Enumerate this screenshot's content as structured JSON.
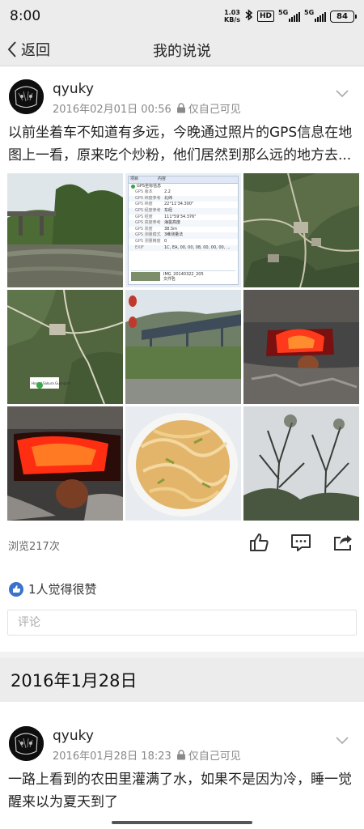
{
  "status_bar": {
    "time": "8:00",
    "speed_value": "1.03",
    "speed_unit": "KB/s",
    "hd_label": "HD",
    "sim1_label": "5G",
    "sim2_label": "5G",
    "battery": "84"
  },
  "nav": {
    "back_label": "返回",
    "title": "我的说说"
  },
  "posts": [
    {
      "username": "qyuky",
      "datetime": "2016年02月01日 00:56",
      "privacy": "仅自己可见",
      "text": "以前坐着车不知道有多远，今晚通过照片的GPS信息在地图上一看，原来吃个炒粉，他们居然到那么远的地方去...",
      "views": "浏览217次",
      "likes_text": "1人觉得很赞",
      "comment_placeholder": "评论"
    },
    {
      "username": "qyuky",
      "datetime": "2016年01月28日 18:23",
      "privacy": "仅自己可见",
      "text": "一路上看到的农田里灌满了水，如果不是因为冷，睡一觉醒来以为夏天到了"
    }
  ],
  "date_section": "2016年1月28日",
  "gps_panel": {
    "header_col1": "项目",
    "header_col2": "内容",
    "group": "GPS坐标信息",
    "rows": [
      [
        "GPS 版本",
        "2.2"
      ],
      [
        "GPS 纬度参考",
        "北纬"
      ],
      [
        "GPS 纬度",
        "22°11'34.300\""
      ],
      [
        "GPS 经度参考",
        "东经"
      ],
      [
        "GPS 经度",
        "111°59'34.376\""
      ],
      [
        "GPS 高度参考",
        "海拔高度"
      ],
      [
        "GPS 高度",
        "38.5m"
      ],
      [
        "GPS 测量模式",
        "3维测量法"
      ],
      [
        "GPS 测量精度",
        "0"
      ],
      [
        "EXIF",
        "1C, EA, 00, 00, 08, 00, 00, 00, ..."
      ]
    ],
    "file_name": "IMG_20140322_205",
    "file_label": "文件名"
  },
  "map_label": "Hostel Sakura Guangchi"
}
